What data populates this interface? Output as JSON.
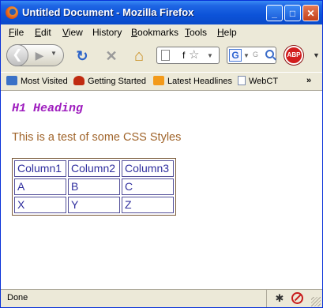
{
  "window": {
    "title": "Untitled Document - Mozilla Firefox",
    "minimize_glyph": "_",
    "maximize_glyph": "□",
    "close_glyph": "✕"
  },
  "menu": {
    "items": [
      {
        "acc": "F",
        "rest": "ile"
      },
      {
        "acc": "E",
        "rest": "dit"
      },
      {
        "acc": "V",
        "rest": "iew"
      },
      {
        "acc": "",
        "rest": "History",
        "under_rest": "H"
      },
      {
        "acc": "B",
        "rest": "ookmarks"
      },
      {
        "acc": "T",
        "rest": "ools"
      },
      {
        "acc": "H",
        "rest": "elp"
      }
    ]
  },
  "toolbar": {
    "back_glyph": "❮",
    "forward_glyph": "▶",
    "reload_glyph": "↻",
    "stop_glyph": "✕",
    "home_glyph": "⌂",
    "url_value": "f",
    "star_glyph": "☆",
    "search_engine_letter": "G",
    "search_placeholder": "G",
    "abp_label": "ABP"
  },
  "bookmarks": {
    "items": [
      "Most Visited",
      "Getting Started",
      "Latest Headlines",
      "WebCT"
    ],
    "more_glyph": "»"
  },
  "page": {
    "heading": "H1 Heading",
    "paragraph": "This is a test of some CSS Styles",
    "table": [
      [
        "Column1",
        "Column2",
        "Column3"
      ],
      [
        "A",
        "B",
        "C"
      ],
      [
        "X",
        "Y",
        "Z"
      ]
    ]
  },
  "status": {
    "text": "Done"
  },
  "colors": {
    "titlebar": "#0c53d9",
    "heading": "#9e1cbe",
    "paragraph": "#a0642a",
    "table_text": "#2f2e9e"
  }
}
